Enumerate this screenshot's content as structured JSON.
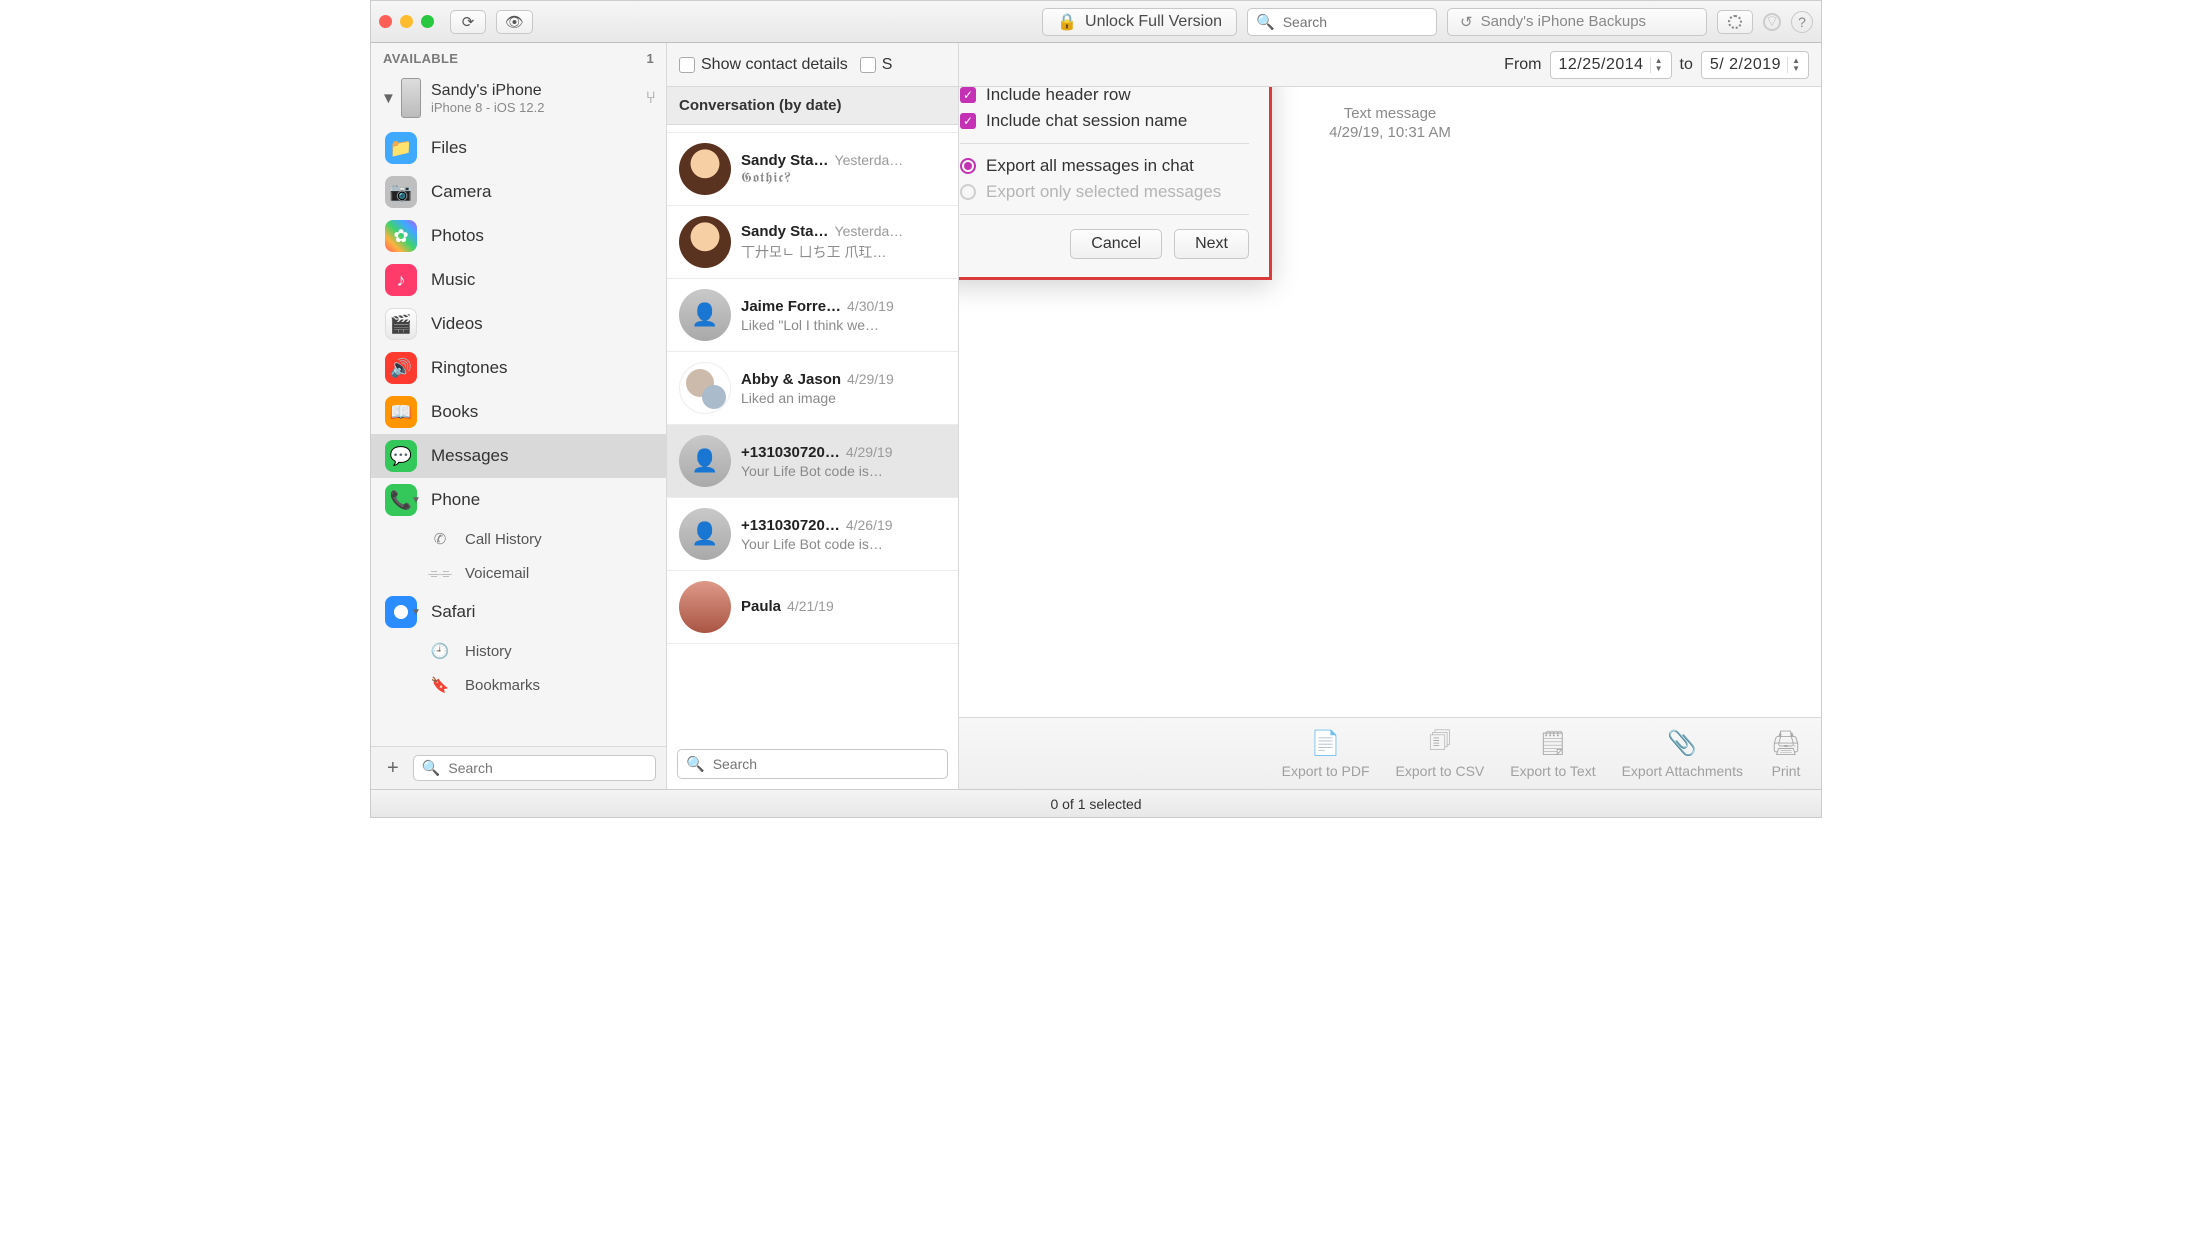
{
  "toolbar": {
    "unlock_label": "Unlock Full Version",
    "search_placeholder": "Search",
    "backup_label": "Sandy's iPhone Backups"
  },
  "sidebar": {
    "header": "AVAILABLE",
    "count": "1",
    "device": {
      "name": "Sandy's iPhone",
      "sub": "iPhone 8 - iOS 12.2"
    },
    "items": [
      {
        "label": "Files"
      },
      {
        "label": "Camera"
      },
      {
        "label": "Photos"
      },
      {
        "label": "Music"
      },
      {
        "label": "Videos"
      },
      {
        "label": "Ringtones"
      },
      {
        "label": "Books"
      },
      {
        "label": "Messages"
      },
      {
        "label": "Phone"
      },
      {
        "label": "Call History"
      },
      {
        "label": "Voicemail"
      },
      {
        "label": "Safari"
      },
      {
        "label": "History"
      },
      {
        "label": "Bookmarks"
      }
    ],
    "search_placeholder": "Search"
  },
  "conversations": {
    "header": "Conversation (by date)",
    "search_placeholder": "Search",
    "items": [
      {
        "name": "Sandy Sta…",
        "date": "Yesterda…",
        "preview": "𝕲𝖔𝖙𝖍𝖎𝖈?"
      },
      {
        "name": "Sandy Sta…",
        "date": "Yesterda…",
        "preview": "丅廾모ㄴ ㄩち㠪 爪玒…"
      },
      {
        "name": "Jaime Forre…",
        "date": "4/30/19",
        "preview": "Liked \"Lol I think we…"
      },
      {
        "name": "Abby & Jason",
        "date": "4/29/19",
        "preview": "Liked an image"
      },
      {
        "name": "+131030720…",
        "date": "4/29/19",
        "preview": "Your Life Bot code is…"
      },
      {
        "name": "+131030720…",
        "date": "4/26/19",
        "preview": "Your Life Bot code is…"
      },
      {
        "name": "Paula",
        "date": "4/21/19",
        "preview": ""
      }
    ]
  },
  "detail": {
    "show_contact": "Show contact details",
    "show_s": "S",
    "from_label": "From",
    "from_value": "12/25/2014",
    "to_label": "to",
    "to_value": "5/ 2/2019",
    "msgmeta": {
      "type": "Text message",
      "date": "4/29/19, 10:31 AM"
    }
  },
  "export": {
    "include_header": "Include header row",
    "include_session": "Include chat session name",
    "opt_all": "Export all messages in chat",
    "opt_selected": "Export only selected messages",
    "cancel": "Cancel",
    "next": "Next"
  },
  "actions": {
    "pdf": "Export to PDF",
    "csv": "Export to CSV",
    "text": "Export to Text",
    "attach": "Export Attachments",
    "print": "Print"
  },
  "footer": {
    "status": "0 of 1 selected"
  }
}
